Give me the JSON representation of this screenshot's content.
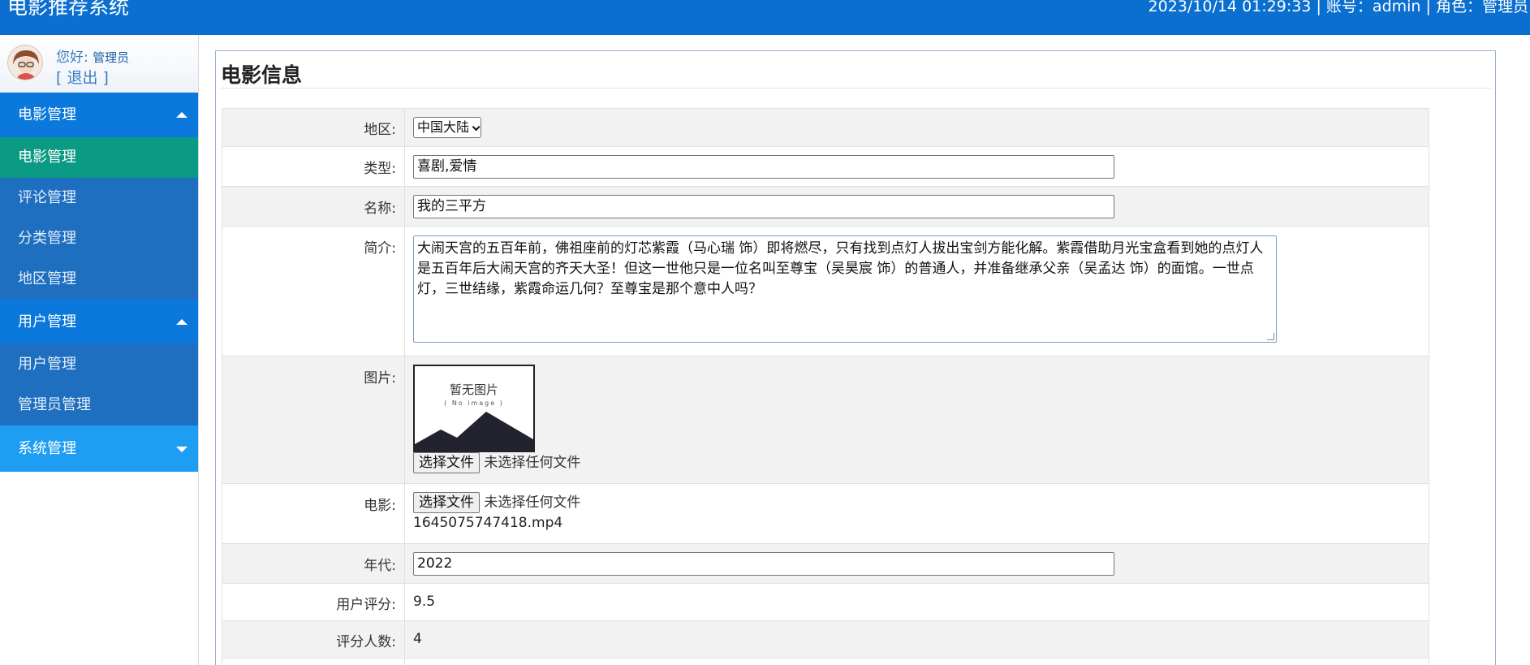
{
  "header": {
    "app_title": "电影推荐系统",
    "datetime": "2023/10/14 01:29:33",
    "account_label": "账号：",
    "account": "admin",
    "role_label": "角色：",
    "role": "管理员",
    "separator": "|"
  },
  "user": {
    "greeting": "您好: ",
    "name": "管理员",
    "logout": "[ 退出 ]"
  },
  "sidebar": {
    "groups": [
      {
        "label": "电影管理",
        "items": [
          {
            "label": "电影管理"
          },
          {
            "label": "评论管理"
          },
          {
            "label": "分类管理"
          },
          {
            "label": "地区管理"
          }
        ]
      },
      {
        "label": "用户管理",
        "items": [
          {
            "label": "用户管理"
          },
          {
            "label": "管理员管理"
          }
        ]
      },
      {
        "label": "系统管理",
        "items": []
      }
    ]
  },
  "form": {
    "title": "电影信息",
    "region_label": "地区:",
    "region_value": "中国大陆",
    "type_label": "类型:",
    "type_value": "喜剧,爱情",
    "name_label": "名称:",
    "name_value": "我的三平方",
    "intro_label": "简介:",
    "intro_value": "大闹天宫的五百年前，佛祖座前的灯芯紫霞（马心瑞 饰）即将燃尽，只有找到点灯人拔出宝剑方能化解。紫霞借助月光宝盒看到她的点灯人是五百年后大闹天宫的齐天大圣！但这一世他只是一位名叫至尊宝（吴昊宸 饰）的普通人，并准备继承父亲（吴孟达 饰）的面馆。一世点灯，三世结缘，紫霞命运几何？至尊宝是那个意中人吗？",
    "image_label": "图片:",
    "noimage_text": "暂无图片",
    "noimage_sub": "( No image )",
    "file_button": "选择文件",
    "no_file": "未选择任何文件",
    "movie_label": "电影:",
    "movie_file": "1645075747418.mp4",
    "year_label": "年代:",
    "year_value": "2022",
    "rating_label": "用户评分:",
    "rating_value": "9.5",
    "raters_label": "评分人数:",
    "raters_value": "4"
  },
  "colors": {
    "topbar": "#0b6fcf",
    "menu_group": "#0b78db",
    "menu_group_system": "#1e9ef3",
    "menu_item": "#1e6fbf",
    "menu_active": "#0b9a83"
  }
}
